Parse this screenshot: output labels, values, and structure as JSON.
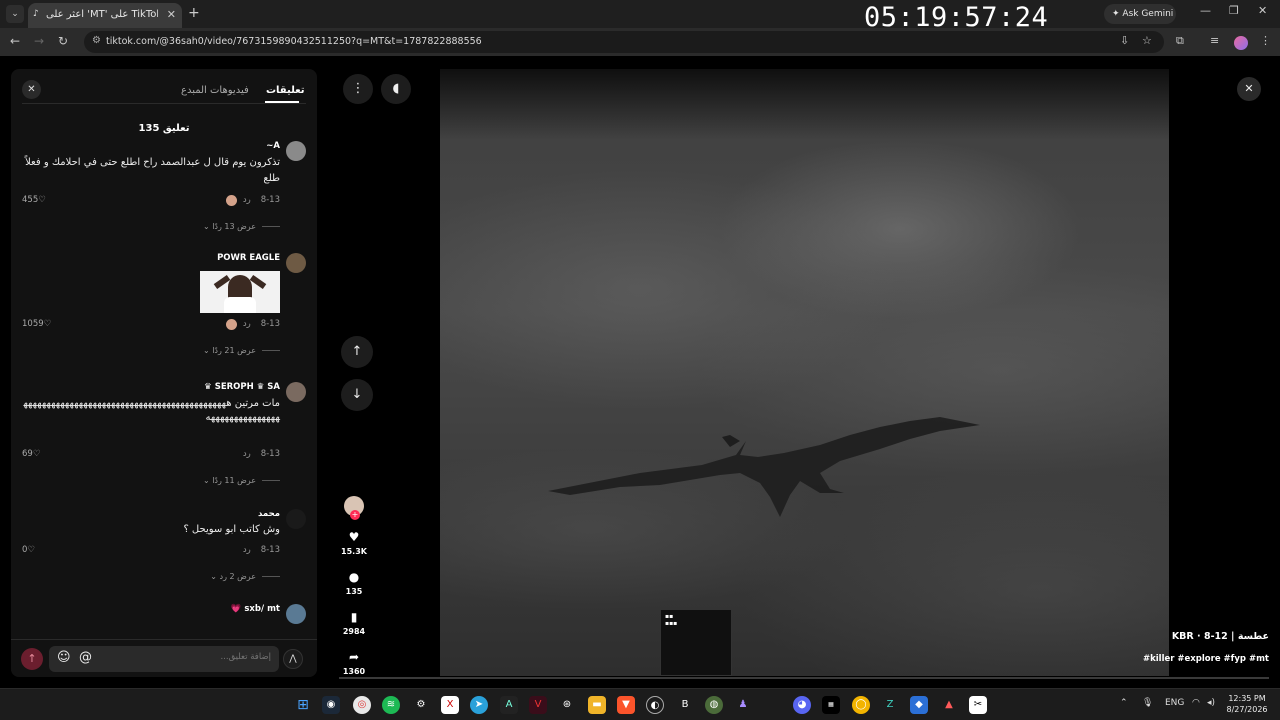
{
  "browser": {
    "tab_title": "اعثر على 'MT' على TikTok |",
    "tab_favicon": "tiktok-icon",
    "time_overlay": "05:19:57:24",
    "ask_gemini": "Ask Gemini",
    "url": "tiktok.com/@36sah0/video/7673159890432511250?q=MT&t=1787822888556"
  },
  "panel": {
    "tab_comments": "تعليقات",
    "tab_creator_videos": "فيديوهات المبدع",
    "comment_count": "135 تعليق",
    "comments": [
      {
        "username": "A~",
        "text": "تذكرون يوم قال ل عبدالصمد راح اطلع حتى في احلامك و فعلاً طلع",
        "date": "8-13",
        "reply": "رد",
        "likes": "455",
        "view_replies": "عرض 13 ردًا"
      },
      {
        "username": "POWR EAGLE",
        "text": "",
        "date": "8-13",
        "reply": "رد",
        "likes": "1059",
        "view_replies": "عرض 21 ردًا"
      },
      {
        "username": "SEROPH ♛ SA ♛",
        "text": "مات مرتين ههههههههههههههههههههههههههههههههههههههههههههههههههههههههههههه",
        "date": "8-13",
        "reply": "رد",
        "likes": "69",
        "view_replies": "عرض 11 ردًا"
      },
      {
        "username": "محمد",
        "text": "وش كاتب ابو سويحل ؟",
        "date": "8-13",
        "reply": "رد",
        "likes": "0",
        "view_replies": "عرض 2 رد"
      },
      {
        "username": "sxb/ mt 💗",
        "text": ""
      }
    ],
    "input_placeholder": "إضافة تعليق...",
    "at_symbol": "@"
  },
  "video": {
    "likes": "15.3K",
    "comments": "135",
    "saves": "2984",
    "shares": "1360",
    "caption_title": "عطسة | KBR · 8-12",
    "caption_tags": "#killer #explore #fyp #mt",
    "progress_fraction": 0.0
  },
  "taskbar": {
    "lang": "ENG",
    "time": "12:35 PM",
    "date": "8/27/2026"
  },
  "colors": {
    "accent": "#fe2c55",
    "panel_bg": "#121212"
  }
}
